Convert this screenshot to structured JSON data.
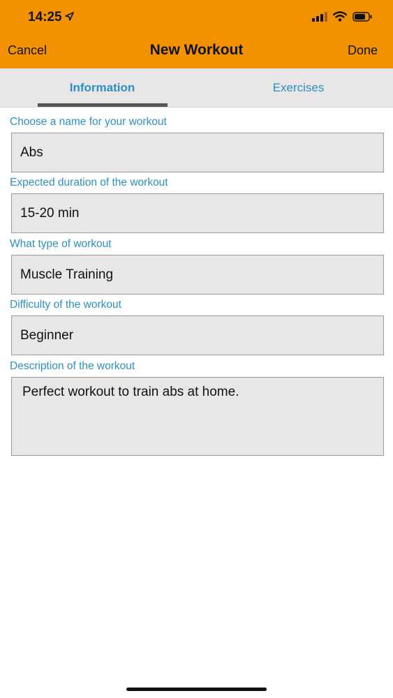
{
  "status_bar": {
    "time": "14:25",
    "icons": [
      "location-arrow-icon",
      "signal-icon",
      "wifi-icon",
      "battery-icon"
    ]
  },
  "nav": {
    "cancel_label": "Cancel",
    "title": "New Workout",
    "done_label": "Done"
  },
  "tabs": [
    {
      "label": "Information",
      "selected": true
    },
    {
      "label": "Exercises",
      "selected": false
    }
  ],
  "form": {
    "name_label": "Choose a name for your workout",
    "name_value": "Abs",
    "duration_label": "Expected duration of the workout",
    "duration_value": "15-20 min",
    "type_label": "What type of workout",
    "type_value": "Muscle Training",
    "difficulty_label": "Difficulty of the workout",
    "difficulty_value": "Beginner",
    "description_label": "Description of the workout",
    "description_value": "Perfect workout to train abs at home."
  },
  "colors": {
    "header": "#f39200",
    "accent": "#2a91c8",
    "field_bg": "#e8e6e6"
  }
}
